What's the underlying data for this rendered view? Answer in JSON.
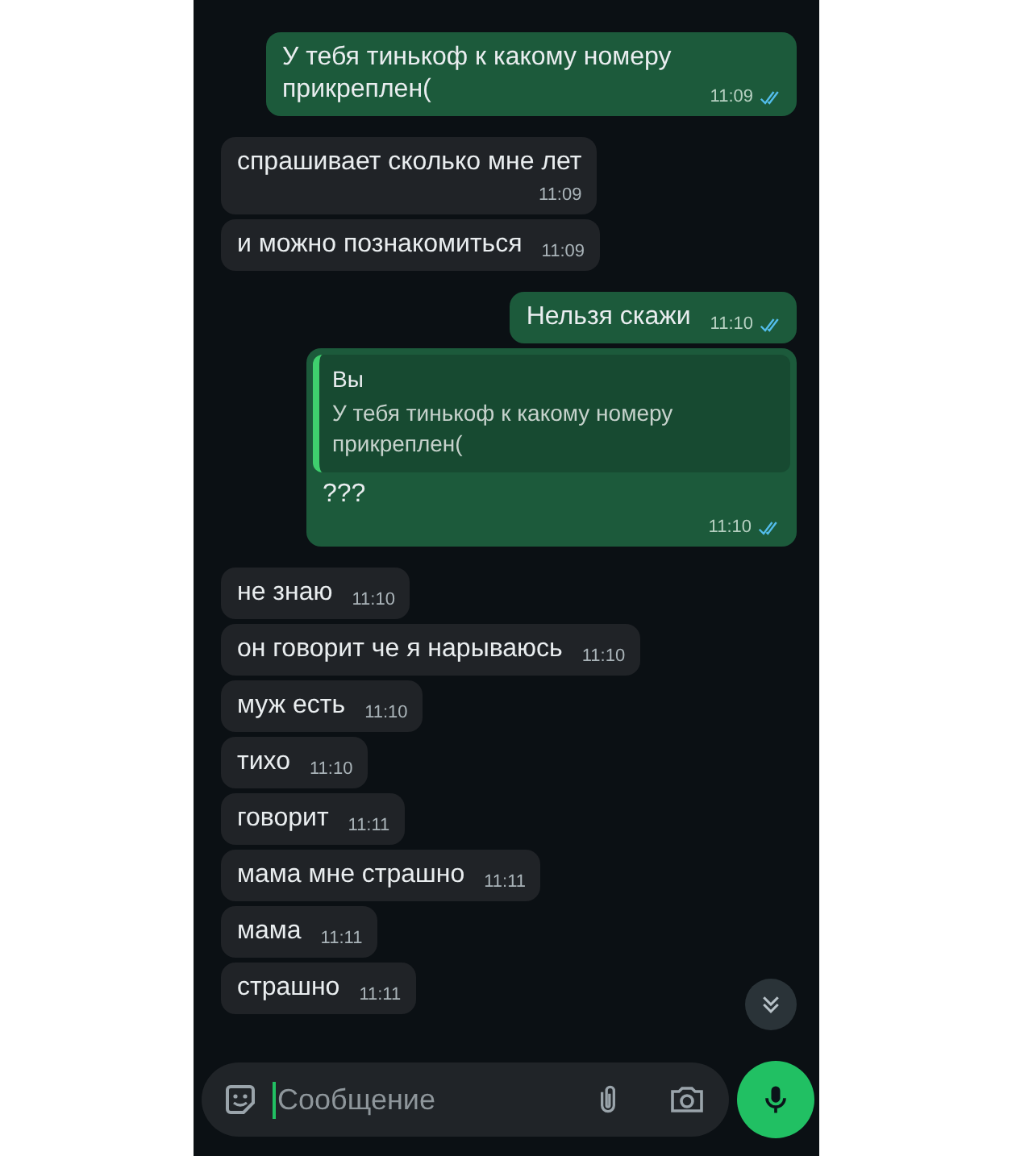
{
  "messages": [
    {
      "kind": "out",
      "text": "У тебя тинькоф к какому номеру прикреплен(",
      "time": "11:09",
      "read": true
    },
    {
      "kind": "in",
      "text": "спрашивает сколько мне лет",
      "time": "11:09",
      "break": true
    },
    {
      "kind": "in",
      "text": "и можно познакомиться",
      "time": "11:09"
    },
    {
      "kind": "out",
      "text": "Нельзя скажи",
      "time": "11:10",
      "read": true
    },
    {
      "kind": "reply",
      "quote_author": "Вы",
      "quote_text": "У тебя тинькоф к какому номеру прикреплен(",
      "text": "???",
      "time": "11:10",
      "read": true
    },
    {
      "kind": "in",
      "text": "не знаю",
      "time": "11:10"
    },
    {
      "kind": "in",
      "text": "он говорит че я нарываюсь",
      "time": "11:10"
    },
    {
      "kind": "in",
      "text": "муж есть",
      "time": "11:10"
    },
    {
      "kind": "in",
      "text": "тихо",
      "time": "11:10"
    },
    {
      "kind": "in",
      "text": "говорит",
      "time": "11:11"
    },
    {
      "kind": "in",
      "text": "мама мне страшно",
      "time": "11:11"
    },
    {
      "kind": "in",
      "text": "мама",
      "time": "11:11"
    },
    {
      "kind": "in",
      "text": "страшно",
      "time": "11:11"
    }
  ],
  "composer": {
    "placeholder": "Сообщение"
  }
}
